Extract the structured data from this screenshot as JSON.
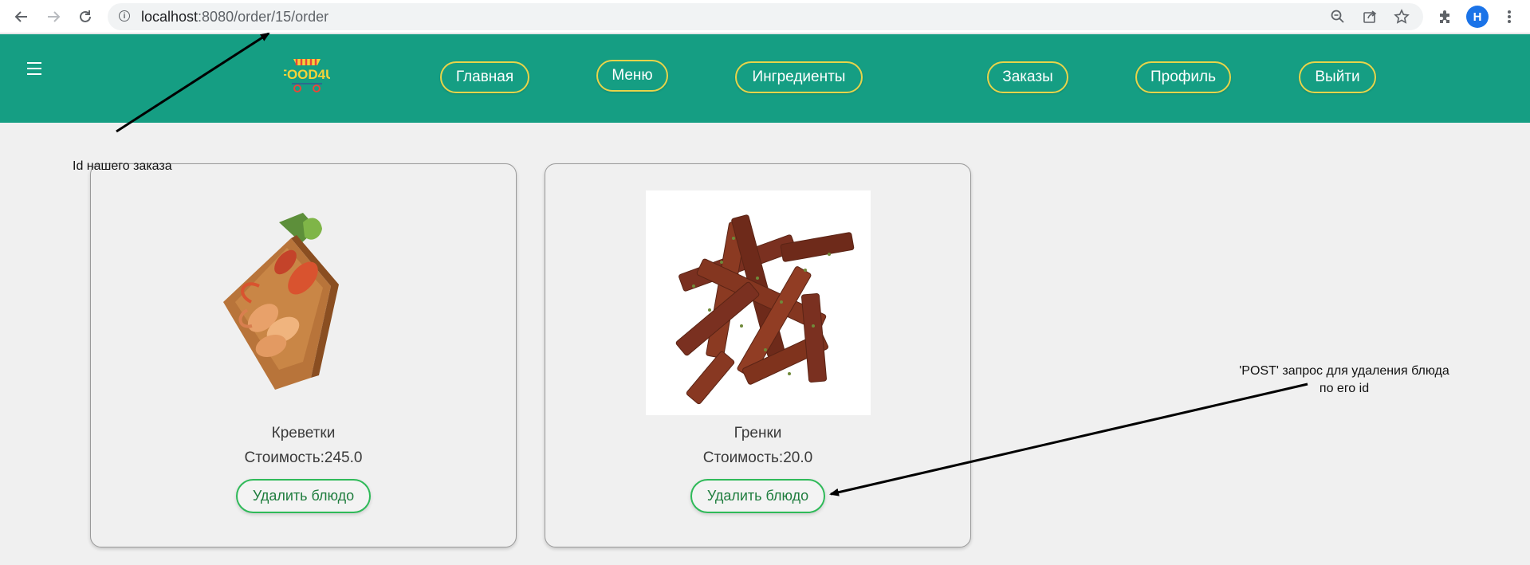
{
  "browser": {
    "url_host": "localhost",
    "url_path": ":8080/order/15/order",
    "profile_initial": "H",
    "icons": [
      "back-icon",
      "forward-icon",
      "reload-icon",
      "info-icon",
      "zoom-icon",
      "share-icon",
      "star-icon",
      "extensions-icon",
      "menu-dots-icon"
    ]
  },
  "header": {
    "logo_text": "FOOD4U",
    "nav": [
      {
        "label": "Главная"
      },
      {
        "label": "Меню"
      },
      {
        "label": "Ингредиенты"
      },
      {
        "label": "Заказы"
      },
      {
        "label": "Профиль"
      },
      {
        "label": "Выйти"
      }
    ]
  },
  "dishes": [
    {
      "name": "Креветки",
      "price": "Стоимость:245.0",
      "delete_label": "Удалить блюдо"
    },
    {
      "name": "Гренки",
      "price": "Стоимость:20.0",
      "delete_label": "Удалить блюдо"
    }
  ],
  "annotations": {
    "order_id_note": "Id нашего заказа",
    "post_note_line1": "'POST' запрос для удаления блюда",
    "post_note_line2": "по его id"
  },
  "colors": {
    "header_bg": "#159e83",
    "nav_border": "#e7d44a",
    "delete_border": "#2fba59",
    "page_bg": "#f0f0f0"
  }
}
